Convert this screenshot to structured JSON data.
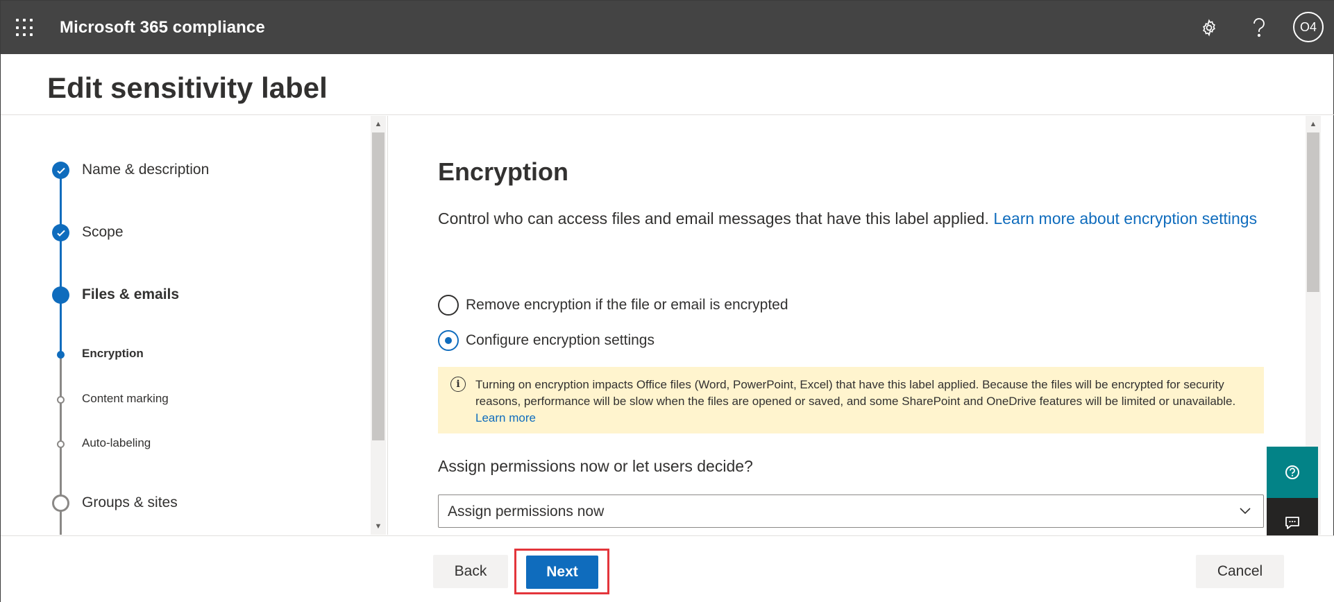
{
  "app": {
    "title": "Microsoft 365 compliance",
    "avatar_initials": "O4"
  },
  "page": {
    "title": "Edit sensitivity label"
  },
  "steps": [
    {
      "label": "Name & description",
      "state": "done"
    },
    {
      "label": "Scope",
      "state": "done"
    },
    {
      "label": "Files & emails",
      "state": "current"
    },
    {
      "label": "Encryption",
      "state": "sub-current"
    },
    {
      "label": "Content marking",
      "state": "sub-pending"
    },
    {
      "label": "Auto-labeling",
      "state": "sub-pending"
    },
    {
      "label": "Groups & sites",
      "state": "pending"
    }
  ],
  "main": {
    "title": "Encryption",
    "description": "Control who can access files and email messages that have this label applied.",
    "learn_more_link": "Learn more about encryption settings",
    "radio_options": [
      {
        "label": "Remove encryption if the file or email is encrypted",
        "checked": false
      },
      {
        "label": "Configure encryption settings",
        "checked": true
      }
    ],
    "info": {
      "text": "Turning on encryption impacts Office files (Word, PowerPoint, Excel) that have this label applied. Because the files will be encrypted for security reasons, performance will be slow when the files are opened or saved, and some SharePoint and OneDrive features will be limited or unavailable.",
      "link": "Learn more"
    },
    "question": "Assign permissions now or let users decide?",
    "dropdown_value": "Assign permissions now"
  },
  "footer": {
    "back": "Back",
    "next": "Next",
    "cancel": "Cancel"
  },
  "colors": {
    "accent": "#0f6cbd",
    "topbar": "#444444",
    "warning_bg": "#fff4ce",
    "highlight": "#e3353b",
    "help_float": "#038387"
  },
  "icons": {
    "waffle": "app-launcher-icon",
    "settings": "gear-icon",
    "help": "question-icon",
    "info": "info-icon",
    "dropdown": "chevron-down-icon"
  }
}
